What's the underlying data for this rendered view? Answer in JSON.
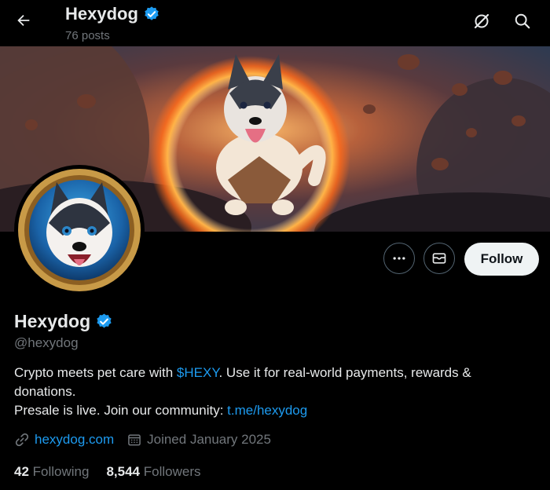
{
  "header": {
    "title": "Hexydog",
    "posts": "76 posts"
  },
  "profile": {
    "name": "Hexydog",
    "handle": "@hexydog",
    "bio_part1": "Crypto meets pet care with ",
    "bio_ticker": "$HEXY",
    "bio_part2": ". Use it for real-world payments, rewards & donations.",
    "bio_line2_prefix": "Presale is live. Join our community: ",
    "bio_link": "t.me/hexydog",
    "website": "hexydog.com",
    "joined": "Joined January 2025",
    "following_count": "42",
    "following_label": "Following",
    "followers_count": "8,544",
    "followers_label": "Followers"
  },
  "actions": {
    "follow_label": "Follow"
  },
  "icons": {
    "back": "back-arrow-icon",
    "grok": "grok-icon",
    "search": "search-icon",
    "more": "more-icon",
    "message": "message-icon",
    "verified": "verified-badge-icon",
    "link": "link-icon",
    "calendar": "calendar-icon"
  },
  "colors": {
    "background": "#000000",
    "accent": "#1d9bf0",
    "text": "#e7e9ea",
    "muted": "#71767b",
    "follow_bg": "#eff3f4"
  }
}
